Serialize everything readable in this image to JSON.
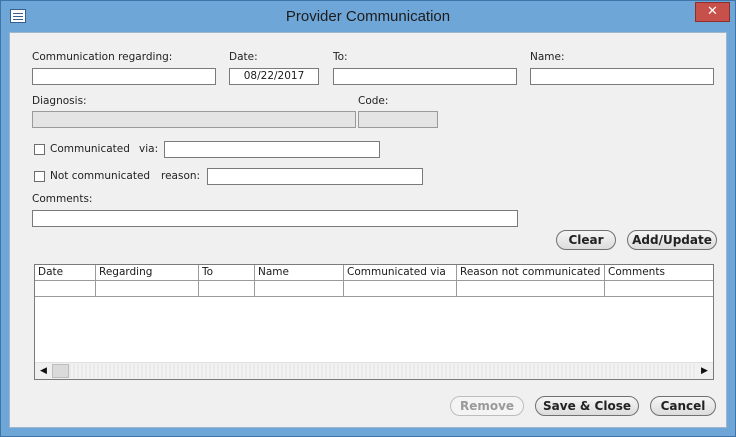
{
  "window": {
    "title": "Provider Communication",
    "close_glyph": "✕"
  },
  "form": {
    "communication_regarding": {
      "label": "Communication regarding:",
      "value": ""
    },
    "date": {
      "label": "Date:",
      "value": "08/22/2017"
    },
    "to": {
      "label": "To:",
      "value": ""
    },
    "name": {
      "label": "Name:",
      "value": ""
    },
    "diagnosis": {
      "label": "Diagnosis:",
      "value": ""
    },
    "code": {
      "label": "Code:",
      "value": ""
    },
    "communicated": {
      "label": "Communicated",
      "checked": false,
      "via_label": "via:",
      "via_value": ""
    },
    "not_communicated": {
      "label": "Not communicated",
      "checked": false,
      "reason_label": "reason:",
      "reason_value": ""
    },
    "comments": {
      "label": "Comments:",
      "value": ""
    }
  },
  "buttons": {
    "clear": "Clear",
    "add_update": "Add/Update",
    "remove": "Remove",
    "save_close": "Save & Close",
    "cancel": "Cancel"
  },
  "grid": {
    "columns": [
      "Date",
      "Regarding",
      "To",
      "Name",
      "Communicated via",
      "Reason not communicated",
      "Comments"
    ],
    "rows": [
      [
        "",
        "",
        "",
        "",
        "",
        "",
        ""
      ]
    ]
  },
  "scrollbar": {
    "left_arrow": "◀",
    "right_arrow": "▶"
  },
  "icons": {
    "app": "form-icon",
    "close": "close-icon"
  },
  "colors": {
    "frame": "#6fa6d8",
    "close_button": "#c7504a",
    "client": "#f0f0f0"
  }
}
